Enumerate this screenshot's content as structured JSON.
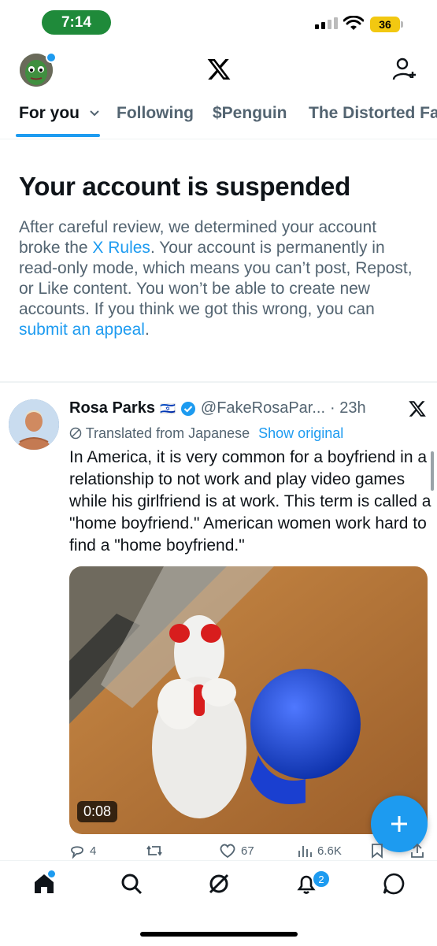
{
  "status_bar": {
    "time": "7:14",
    "battery": "36"
  },
  "header": {
    "logo": "X"
  },
  "tabs": [
    {
      "label": "For you",
      "active": true
    },
    {
      "label": "Following"
    },
    {
      "label": "$Penguin"
    },
    {
      "label": "The Distorted Fa"
    }
  ],
  "suspension": {
    "title": "Your account is suspended",
    "body_1": "After careful review, we determined your account broke the ",
    "rules_link": "X Rules",
    "body_2": ". Your account is permanently in read-only mode, which means you can’t post, Repost, or Like content. You won’t be able to create new accounts. If you think we got this wrong, you can ",
    "appeal_link": "submit an appeal",
    "body_3": "."
  },
  "post": {
    "name": "Rosa Parks",
    "flag": "🇮🇱",
    "handle": "@FakeRosaPar...",
    "time": "· 23h",
    "translated_label": "Translated from Japanese",
    "show_original": "Show original",
    "text": "In America, it is very common for a boyfriend in a relationship to not work and play video games while his girlfriend is at work. This term is called a \"home boyfriend.\" American women work hard to find a \"home boyfriend.\"",
    "video_duration": "0:08",
    "replies": "4",
    "reposts": "",
    "likes": "67",
    "views": "6.6K"
  },
  "bottom_nav": {
    "notifications_badge": "2"
  },
  "colors": {
    "accent": "#1d9bf0",
    "muted": "#536471",
    "status_time_bg": "#1f8a3a",
    "battery": "#f2c811"
  }
}
